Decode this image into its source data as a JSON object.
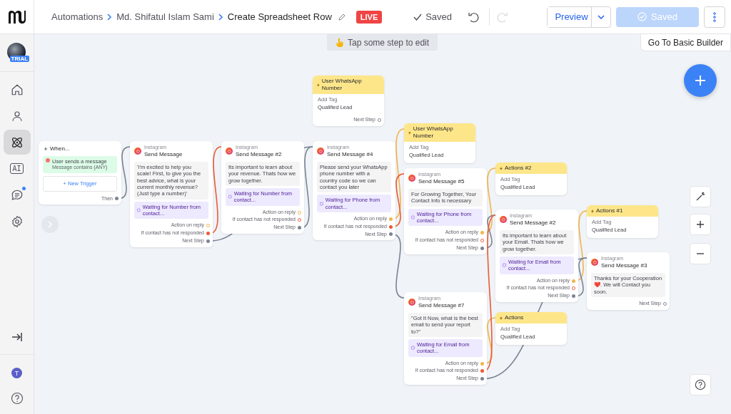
{
  "topbar": {
    "breadcrumbs": [
      "Automations",
      "Md. Shifatul Islam Sami",
      "Create Spreadsheet Row"
    ],
    "status_badge": "LIVE",
    "save_state": "Saved",
    "redo_disabled": true,
    "preview_button": "Preview",
    "saved_button": {
      "label": "Saved",
      "disabled": true
    }
  },
  "sidebar": {
    "account_badge": "TRIAL",
    "items": [
      {
        "kind": "home",
        "selected": false
      },
      {
        "kind": "contacts",
        "selected": false
      },
      {
        "kind": "flows",
        "selected": true
      },
      {
        "kind": "ai",
        "label": "AI",
        "selected": false
      },
      {
        "kind": "chat",
        "selected": false,
        "notification": true
      },
      {
        "kind": "settings",
        "selected": false
      }
    ],
    "user_initial": "T"
  },
  "canvas": {
    "hint": "Tap some step to edit",
    "basic_builder_link": "Go To Basic Builder",
    "nodes": [
      {
        "kind": "trigger",
        "title": "When...",
        "trigger": "User sends a message",
        "detail": "Message contains {ANY}",
        "add_button": "+ New Trigger",
        "ports": [
          {
            "kind": "then",
            "label": "Then",
            "connected": true
          }
        ]
      },
      {
        "kind": "message",
        "channel": "Instagram",
        "title": "Send Message",
        "text": "'I'm excited to help you scale! First, to give you the best advice, what is your current monthly revenue? (Just type a number)'",
        "waiting": "Waiting for Number from contact...",
        "ports": [
          {
            "kind": "reply",
            "label": "Action on reply",
            "connected": false
          },
          {
            "kind": "no_response",
            "label": "If contact has not responded",
            "connected": true
          },
          {
            "kind": "next",
            "label": "Next Step",
            "connected": true
          }
        ]
      },
      {
        "kind": "message",
        "channel": "Instagram",
        "title": "Send Message #2",
        "text": "Its important to learn about your revenue. Thats how we grow together.",
        "waiting": "Waiting for Number from contact...",
        "ports": [
          {
            "kind": "reply",
            "label": "Action on reply",
            "connected": false
          },
          {
            "kind": "no_response",
            "label": "If contact has not responded",
            "connected": false
          },
          {
            "kind": "next",
            "label": "Next Step",
            "connected": true
          }
        ]
      },
      {
        "kind": "action",
        "title": "User WhatsApp Number",
        "field": "Add Tag",
        "value": "Qualified Lead",
        "ports": [
          {
            "kind": "next",
            "label": "Next Step",
            "connected": false
          }
        ]
      },
      {
        "kind": "message",
        "channel": "Instagram",
        "title": "Send Message #4",
        "text": "Please send your WhatsApp phone number with a country code so we can contact you later",
        "waiting": "Waiting for Phone from contact...",
        "ports": [
          {
            "kind": "reply",
            "label": "Action on reply",
            "connected": true
          },
          {
            "kind": "no_response",
            "label": "If contact has not responded",
            "connected": true
          },
          {
            "kind": "next",
            "label": "Next Step",
            "connected": true
          }
        ]
      },
      {
        "kind": "action",
        "title": "User WhatsApp Number",
        "field": "Add Tag",
        "value": "Qualified Lead"
      },
      {
        "kind": "message",
        "channel": "Instagram",
        "title": "Send Message #5",
        "text": "For Growing Together, Your Contact Info is necessary",
        "waiting": "Waiting for Phone from contact...",
        "ports": [
          {
            "kind": "reply",
            "label": "Action on reply",
            "connected": true
          },
          {
            "kind": "no_response",
            "label": "If contact has not responded",
            "connected": false
          },
          {
            "kind": "next",
            "label": "Next Step",
            "connected": true
          }
        ]
      },
      {
        "kind": "action",
        "title": "Actions #2",
        "field": "Add Tag",
        "value": "Qualified Lead"
      },
      {
        "kind": "message",
        "channel": "Instagram",
        "title": "Send Message #2",
        "text": "Its important to learn about your Email. Thats how we grow together.",
        "waiting": "Waiting for Email from contact...",
        "ports": [
          {
            "kind": "reply",
            "label": "Action on reply",
            "connected": true
          },
          {
            "kind": "no_response",
            "label": "If contact has not responded",
            "connected": false
          },
          {
            "kind": "next",
            "label": "Next Step",
            "connected": true
          }
        ]
      },
      {
        "kind": "action",
        "title": "Actions #1",
        "field": "Add Tag",
        "value": "Qualified Lead"
      },
      {
        "kind": "message",
        "channel": "Instagram",
        "title": "Send Message #3",
        "text": "Thanks for your Cooperation ❤️. We will Contact you soon.",
        "ports": [
          {
            "kind": "next",
            "label": "Next Step",
            "connected": false
          }
        ]
      },
      {
        "kind": "message",
        "channel": "Instagram",
        "title": "Send Message #7",
        "text": "\"Got It Now, what is the best email to send your report to?\"",
        "waiting": "Waiting for Email from contact...",
        "ports": [
          {
            "kind": "reply",
            "label": "Action on reply",
            "connected": true
          },
          {
            "kind": "no_response",
            "label": "If contact has not responded",
            "connected": true
          },
          {
            "kind": "next",
            "label": "Next Step",
            "connected": true
          }
        ]
      },
      {
        "kind": "action",
        "title": "Actions",
        "field": "Add Tag",
        "value": "Qualified Lead"
      }
    ]
  }
}
